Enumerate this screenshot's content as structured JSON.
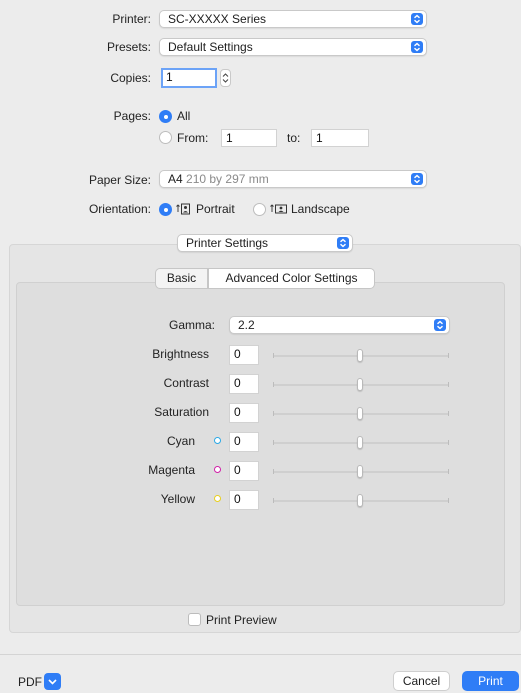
{
  "printer": {
    "label": "Printer:",
    "value": "SC-XXXXX Series"
  },
  "presets": {
    "label": "Presets:",
    "value": "Default Settings"
  },
  "copies": {
    "label": "Copies:",
    "value": "1"
  },
  "pages": {
    "label": "Pages:",
    "all_label": "All",
    "from_label": "From:",
    "from_value": "1",
    "to_label": "to:",
    "to_value": "1"
  },
  "paper_size": {
    "label": "Paper Size:",
    "name": "A4",
    "dims": "210 by 297 mm"
  },
  "orientation": {
    "label": "Orientation:",
    "portrait": "Portrait",
    "landscape": "Landscape"
  },
  "section_popup": {
    "value": "Printer Settings"
  },
  "tabs": [
    {
      "label": "Basic",
      "selected": false
    },
    {
      "label": "Advanced Color Settings",
      "selected": true
    }
  ],
  "gamma": {
    "label": "Gamma:",
    "value": "2.2"
  },
  "adjustments": [
    {
      "label": "Brightness",
      "value": "0"
    },
    {
      "label": "Contrast",
      "value": "0"
    },
    {
      "label": "Saturation",
      "value": "0"
    },
    {
      "label": "Cyan",
      "value": "0",
      "color": "#2aa8e6"
    },
    {
      "label": "Magenta",
      "value": "0",
      "color": "#d11fa8"
    },
    {
      "label": "Yellow",
      "value": "0",
      "color": "#e8cf1e"
    }
  ],
  "print_preview": {
    "label": "Print Preview",
    "checked": false
  },
  "footer": {
    "pdf_label": "PDF",
    "cancel_label": "Cancel",
    "print_label": "Print"
  },
  "colors": {
    "accent": "#2f7df6"
  }
}
